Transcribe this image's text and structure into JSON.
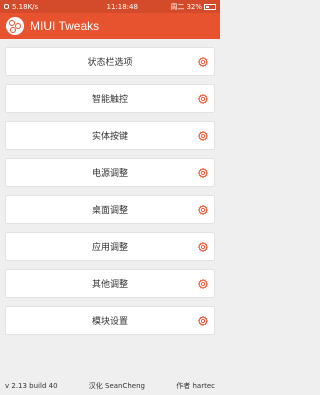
{
  "status_bar": {
    "speed": "5.18K/s",
    "time": "11:18:48",
    "day": "周二",
    "battery": "32%"
  },
  "app_bar": {
    "title": "MIUI Tweaks",
    "logo_icon": "app-logo-icon"
  },
  "menu": {
    "items": [
      {
        "label": "状态栏选项"
      },
      {
        "label": "智能触控"
      },
      {
        "label": "实体按键"
      },
      {
        "label": "电源调整"
      },
      {
        "label": "桌面调整"
      },
      {
        "label": "应用调整"
      },
      {
        "label": "其他调整"
      },
      {
        "label": "模块设置"
      }
    ],
    "item_icon": "gear-icon"
  },
  "footer": {
    "version": "v 2.13 build 40",
    "translator": "汉化 SeanCheng",
    "author": "作者 hartec"
  },
  "colors": {
    "accent": "#e8532f",
    "status_bar": "#d44b2b",
    "background": "#efefef",
    "icon": "#e8532f"
  }
}
